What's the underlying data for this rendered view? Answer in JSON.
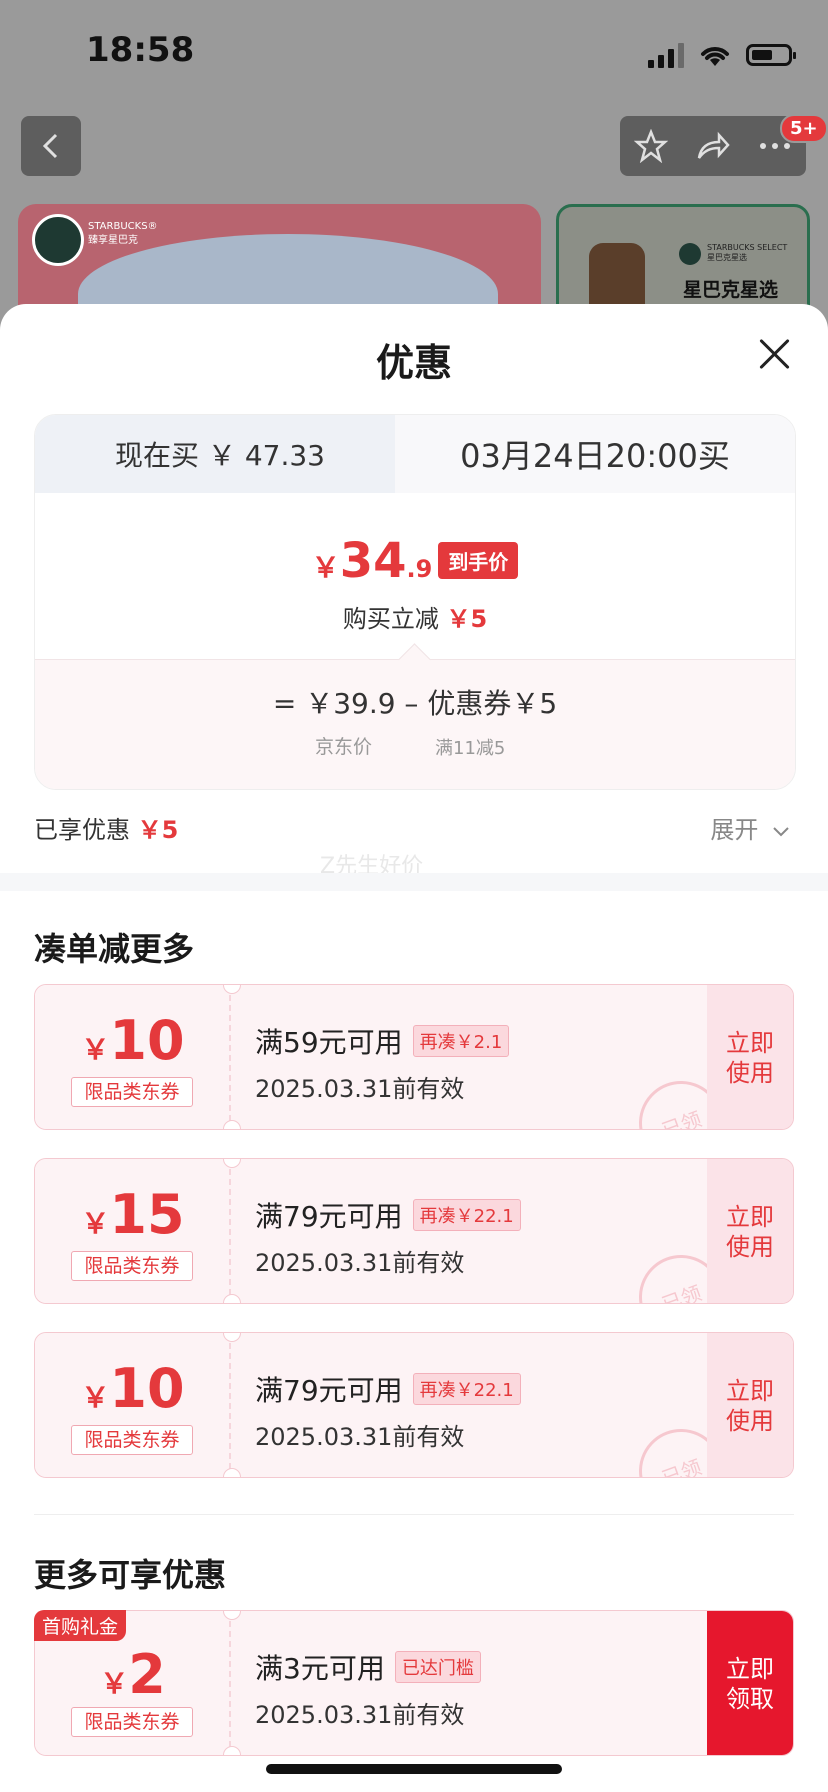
{
  "status_bar": {
    "time": "18:58"
  },
  "top_nav": {
    "badge": "5+"
  },
  "banners": {
    "left_brand_top": "STARBUCKS®",
    "left_brand_sub": "臻享星巴克",
    "right_small_top": "STARBUCKS SELECT",
    "right_small_sub": "星巴克星选",
    "right_name": "星巴克星选"
  },
  "sheet": {
    "title": "优惠",
    "tabs": {
      "now": "现在买 ￥ 47.33",
      "later": "03月24日20:00买"
    },
    "final_price": {
      "yen": "￥",
      "int": "34",
      "dec": ".9",
      "tag": "到手价"
    },
    "instant_reduce": {
      "label": "购买立减",
      "amount": "￥5"
    },
    "calc": {
      "line": "=  ￥39.9  –  优惠券￥5",
      "jd_price_label": "京东价",
      "coupon_rule": "满11减5"
    },
    "enjoyed": {
      "label": "已享优惠",
      "amount": "￥5"
    },
    "expand": "展开",
    "watermark": "Z先生好价"
  },
  "section_more": {
    "title": "凑单减更多"
  },
  "coupons": [
    {
      "yen": "￥",
      "amount": "10",
      "kind": "限品类东券",
      "cond": "满59元可用",
      "tag": "再凑￥2.1",
      "exp": "2025.03.31前有效",
      "btn": "立即使用",
      "stamp": "已领"
    },
    {
      "yen": "￥",
      "amount": "15",
      "kind": "限品类东券",
      "cond": "满79元可用",
      "tag": "再凑￥22.1",
      "exp": "2025.03.31前有效",
      "btn": "立即使用",
      "stamp": "已领"
    },
    {
      "yen": "￥",
      "amount": "10",
      "kind": "限品类东券",
      "cond": "满79元可用",
      "tag": "再凑￥22.1",
      "exp": "2025.03.31前有效",
      "btn": "立即使用",
      "stamp": "已领"
    }
  ],
  "section_extra": {
    "title": "更多可享优惠"
  },
  "extra_coupon": {
    "badge": "首购礼金",
    "yen": "￥",
    "amount": "2",
    "kind": "限品类东券",
    "cond": "满3元可用",
    "tag": "已达门槛",
    "exp": "2025.03.31前有效",
    "btn": "立即领取"
  },
  "colors": {
    "accent_red": "#e4393c",
    "strong_red": "#e6172d"
  }
}
